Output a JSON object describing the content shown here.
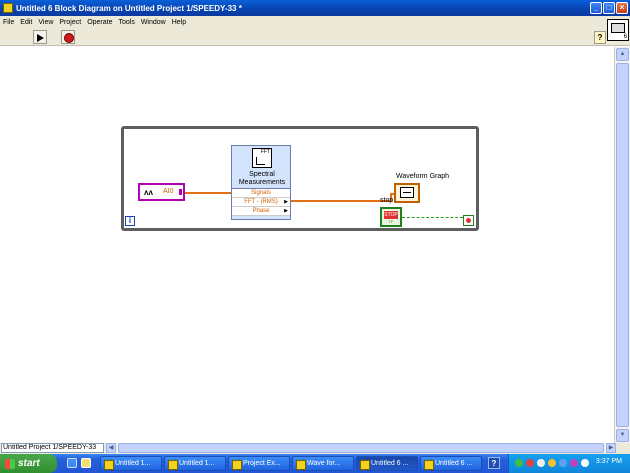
{
  "window": {
    "title": "Untitled 6 Block Diagram on Untitled Project 1/SPEEDY-33 *",
    "buttons": [
      "_",
      "□",
      "×"
    ]
  },
  "menu": [
    "File",
    "Edit",
    "View",
    "Project",
    "Operate",
    "Tools",
    "Window",
    "Help"
  ],
  "toolbar": {
    "help_label": "?",
    "vi_icon_number": "6"
  },
  "diagram": {
    "loop_iteration_label": "i",
    "daq_label": "AI0",
    "daq_wave": "ʌʌ",
    "spectral": {
      "icon_text": "FFT",
      "title_line1": "Spectral",
      "title_line2": "Measurements",
      "rows": [
        "Signals",
        "FFT - (RMS)",
        "Phase"
      ]
    },
    "waveform_graph_label": "Waveform Graph",
    "stop_label": "stop",
    "stop_button_text": "STOP",
    "stop_tf": "TF"
  },
  "status": {
    "context": "Untitled Project 1/SPEEDY-33"
  },
  "taskbar": {
    "start_label": "start",
    "tasks": [
      "Untitled 1...",
      "Untitled 1...",
      "Project Ex...",
      "Wave for...",
      "Untitled 6 ...",
      "Untitled 6 ..."
    ],
    "active_task_index": 4,
    "help_label": "?",
    "clock": "3:37 PM"
  }
}
